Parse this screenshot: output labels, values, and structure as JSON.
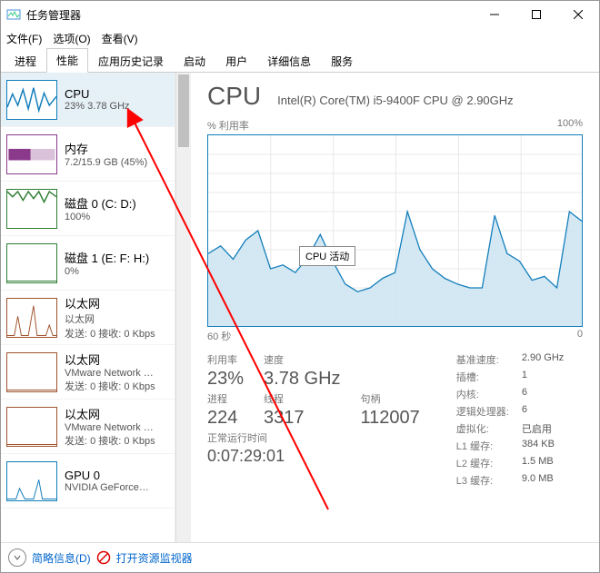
{
  "window": {
    "title": "任务管理器"
  },
  "menu": {
    "file": "文件(F)",
    "options": "选项(O)",
    "view": "查看(V)"
  },
  "tabs": {
    "t0": "进程",
    "t1": "性能",
    "t2": "应用历史记录",
    "t3": "启动",
    "t4": "用户",
    "t5": "详细信息",
    "t6": "服务",
    "active": 1
  },
  "sidebar": {
    "items": [
      {
        "title": "CPU",
        "sub": "23% 3.78 GHz",
        "color": "#117dbb"
      },
      {
        "title": "内存",
        "sub": "7.2/15.9 GB (45%)",
        "color": "#8b3a8b"
      },
      {
        "title": "磁盘 0 (C: D:)",
        "sub": "100%",
        "color": "#2e7d32"
      },
      {
        "title": "磁盘 1 (E: F: H:)",
        "sub": "0%",
        "color": "#2e7d32"
      },
      {
        "title": "以太网",
        "sub": "以太网",
        "sub2": "发送: 0 接收: 0 Kbps",
        "color": "#a0522d"
      },
      {
        "title": "以太网",
        "sub": "VMware Network …",
        "sub2": "发送: 0 接收: 0 Kbps",
        "color": "#a0522d"
      },
      {
        "title": "以太网",
        "sub": "VMware Network …",
        "sub2": "发送: 0 接收: 0 Kbps",
        "color": "#a0522d"
      },
      {
        "title": "GPU 0",
        "sub": "NVIDIA GeForce…",
        "color": "#117dbb"
      }
    ]
  },
  "header": {
    "name": "CPU",
    "model": "Intel(R) Core(TM) i5-9400F CPU @ 2.90GHz"
  },
  "chart": {
    "topLeft": "% 利用率",
    "topRight": "100%",
    "botLeft": "60 秒",
    "botRight": "0",
    "tooltip": "CPU 活动"
  },
  "stats": {
    "util_l": "利用率",
    "util_v": "23%",
    "speed_l": "速度",
    "speed_v": "3.78 GHz",
    "proc_l": "进程",
    "proc_v": "224",
    "thread_l": "线程",
    "thread_v": "3317",
    "handle_l": "句柄",
    "handle_v": "112007",
    "uptime_l": "正常运行时间",
    "uptime_v": "0:07:29:01"
  },
  "info": {
    "k0": "基准速度:",
    "v0": "2.90 GHz",
    "k1": "插槽:",
    "v1": "1",
    "k2": "内核:",
    "v2": "6",
    "k3": "逻辑处理器:",
    "v3": "6",
    "k4": "虚拟化:",
    "v4": "已启用",
    "k5": "L1 缓存:",
    "v5": "384 KB",
    "k6": "L2 缓存:",
    "v6": "1.5 MB",
    "k7": "L3 缓存:",
    "v7": "9.0 MB"
  },
  "footer": {
    "brief": "简略信息(D)",
    "resmon": "打开资源监视器"
  },
  "chart_data": {
    "type": "line",
    "title": "% 利用率",
    "xlabel": "60 秒",
    "ylabel": "% 利用率",
    "ylim": [
      0,
      100
    ],
    "xlim": [
      60,
      0
    ],
    "x": [
      60,
      58,
      56,
      54,
      52,
      50,
      48,
      46,
      44,
      42,
      40,
      38,
      36,
      34,
      32,
      30,
      28,
      26,
      24,
      22,
      20,
      18,
      16,
      14,
      12,
      10,
      8,
      6,
      4,
      2,
      0
    ],
    "values": [
      38,
      42,
      35,
      45,
      50,
      30,
      32,
      28,
      36,
      48,
      34,
      22,
      18,
      20,
      25,
      28,
      60,
      40,
      30,
      25,
      22,
      20,
      20,
      58,
      38,
      34,
      24,
      26,
      20,
      60,
      55
    ],
    "series_name": "CPU 活动"
  }
}
